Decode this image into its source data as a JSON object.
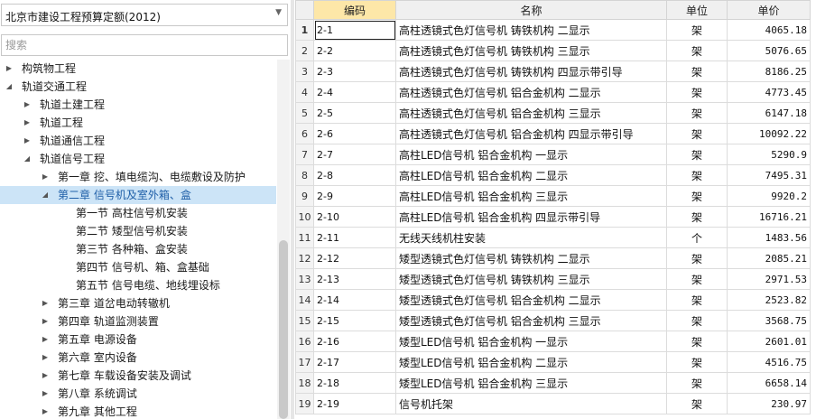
{
  "dropdown": {
    "value": "北京市建设工程预算定额(2012)"
  },
  "search": {
    "placeholder": "搜索"
  },
  "tree": [
    {
      "label": "构筑物工程",
      "toggle": "▶"
    },
    {
      "label": "轨道交通工程",
      "toggle": "◢"
    },
    {
      "label": "轨道土建工程",
      "toggle": "▶"
    },
    {
      "label": "轨道工程",
      "toggle": "▶"
    },
    {
      "label": "轨道通信工程",
      "toggle": "▶"
    },
    {
      "label": "轨道信号工程",
      "toggle": "◢"
    },
    {
      "label": "第一章 挖、填电缆沟、电缆敷设及防护",
      "toggle": "▶"
    },
    {
      "label": "第二章 信号机及室外箱、盒",
      "toggle": "◢"
    },
    {
      "label": "第一节 高柱信号机安装",
      "toggle": ""
    },
    {
      "label": "第二节 矮型信号机安装",
      "toggle": ""
    },
    {
      "label": "第三节 各种箱、盒安装",
      "toggle": ""
    },
    {
      "label": "第四节 信号机、箱、盒基础",
      "toggle": ""
    },
    {
      "label": "第五节 信号电缆、地线埋设标",
      "toggle": ""
    },
    {
      "label": "第三章 道岔电动转辙机",
      "toggle": "▶"
    },
    {
      "label": "第四章 轨道监测装置",
      "toggle": "▶"
    },
    {
      "label": "第五章 电源设备",
      "toggle": "▶"
    },
    {
      "label": "第六章 室内设备",
      "toggle": "▶"
    },
    {
      "label": "第七章 车载设备安装及调试",
      "toggle": "▶"
    },
    {
      "label": "第八章 系统调试",
      "toggle": "▶"
    },
    {
      "label": "第九章 其他工程",
      "toggle": "▶"
    }
  ],
  "grid": {
    "headers": {
      "code": "编码",
      "name": "名称",
      "unit": "单位",
      "price": "单价"
    },
    "rows": [
      {
        "idx": "1",
        "code": "2-1",
        "name": "高柱透镜式色灯信号机 铸铁机构 二显示",
        "unit": "架",
        "price": "4065.18"
      },
      {
        "idx": "2",
        "code": "2-2",
        "name": "高柱透镜式色灯信号机 铸铁机构 三显示",
        "unit": "架",
        "price": "5076.65"
      },
      {
        "idx": "3",
        "code": "2-3",
        "name": "高柱透镜式色灯信号机 铸铁机构 四显示带引导",
        "unit": "架",
        "price": "8186.25"
      },
      {
        "idx": "4",
        "code": "2-4",
        "name": "高柱透镜式色灯信号机 铝合金机构 二显示",
        "unit": "架",
        "price": "4773.45"
      },
      {
        "idx": "5",
        "code": "2-5",
        "name": "高柱透镜式色灯信号机 铝合金机构 三显示",
        "unit": "架",
        "price": "6147.18"
      },
      {
        "idx": "6",
        "code": "2-6",
        "name": "高柱透镜式色灯信号机 铝合金机构 四显示带引导",
        "unit": "架",
        "price": "10092.22"
      },
      {
        "idx": "7",
        "code": "2-7",
        "name": "高柱LED信号机 铝合金机构 一显示",
        "unit": "架",
        "price": "5290.9"
      },
      {
        "idx": "8",
        "code": "2-8",
        "name": "高柱LED信号机 铝合金机构 二显示",
        "unit": "架",
        "price": "7495.31"
      },
      {
        "idx": "9",
        "code": "2-9",
        "name": "高柱LED信号机 铝合金机构 三显示",
        "unit": "架",
        "price": "9920.2"
      },
      {
        "idx": "10",
        "code": "2-10",
        "name": "高柱LED信号机 铝合金机构 四显示带引导",
        "unit": "架",
        "price": "16716.21"
      },
      {
        "idx": "11",
        "code": "2-11",
        "name": "无线天线机柱安装",
        "unit": "个",
        "price": "1483.56"
      },
      {
        "idx": "12",
        "code": "2-12",
        "name": "矮型透镜式色灯信号机 铸铁机构 二显示",
        "unit": "架",
        "price": "2085.21"
      },
      {
        "idx": "13",
        "code": "2-13",
        "name": "矮型透镜式色灯信号机 铸铁机构 三显示",
        "unit": "架",
        "price": "2971.53"
      },
      {
        "idx": "14",
        "code": "2-14",
        "name": "矮型透镜式色灯信号机 铝合金机构 二显示",
        "unit": "架",
        "price": "2523.82"
      },
      {
        "idx": "15",
        "code": "2-15",
        "name": "矮型透镜式色灯信号机 铝合金机构 三显示",
        "unit": "架",
        "price": "3568.75"
      },
      {
        "idx": "16",
        "code": "2-16",
        "name": "矮型LED信号机 铝合金机构 一显示",
        "unit": "架",
        "price": "2601.01"
      },
      {
        "idx": "17",
        "code": "2-17",
        "name": "矮型LED信号机 铝合金机构 二显示",
        "unit": "架",
        "price": "4516.75"
      },
      {
        "idx": "18",
        "code": "2-18",
        "name": "矮型LED信号机 铝合金机构 三显示",
        "unit": "架",
        "price": "6658.14"
      },
      {
        "idx": "19",
        "code": "2-19",
        "name": "信号机托架",
        "unit": "架",
        "price": "230.97"
      }
    ]
  }
}
